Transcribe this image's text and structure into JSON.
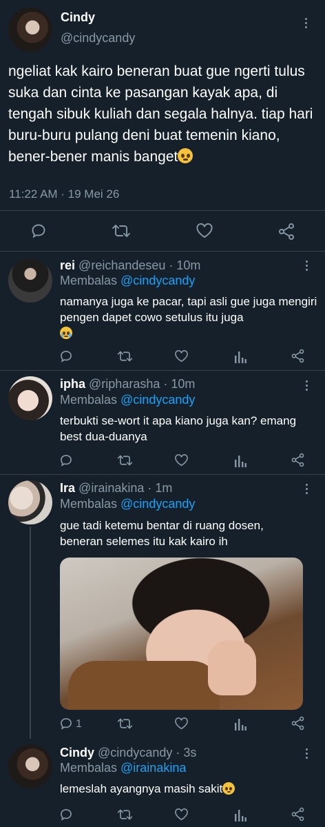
{
  "main_tweet": {
    "name": "Cindy",
    "handle": "@cindycandy",
    "text": "ngeliat kak kairo beneran buat gue ngerti tulus suka dan cinta ke pasangan kayak apa, di tengah sibuk kuliah dan segala halnya. tiap hari buru-buru pulang deni buat temenin kiano, bener-bener manis banget",
    "time": "11:22 AM · 19 Mei 26"
  },
  "replies": [
    {
      "name": "rei",
      "handle": "@reichandeseu",
      "age": " · 10m",
      "replying_label": "Membalas ",
      "replying_to": "@cindycandy",
      "text": "namanya juga ke pacar, tapi asli gue juga mengiri pengen dapet cowo setulus itu juga"
    },
    {
      "name": "ipha",
      "handle": "@ripharasha",
      "age": " · 10m",
      "replying_label": "Membalas ",
      "replying_to": "@cindycandy",
      "text": "terbukti se-wort it apa kiano juga kan? emang best dua-duanya"
    },
    {
      "name": "Ira",
      "handle": "@irainakina",
      "age": " · 1m",
      "replying_label": "Membalas ",
      "replying_to": "@cindycandy",
      "text": "gue tadi ketemu bentar di ruang dosen, beneran selemes itu kak kairo ih",
      "reply_count": "1"
    },
    {
      "name": "Cindy",
      "handle": "@cindycandy",
      "age": " · 3s",
      "replying_label": "Membalas ",
      "replying_to": "@irainakina",
      "text": "lemeslah ayangnya masih sakit"
    }
  ],
  "icons": {
    "reply": "speech-bubble-icon",
    "retweet": "retweet-icon",
    "like": "heart-icon",
    "share": "share-icon",
    "analytics": "analytics-icon",
    "more": "vertical-dots-icon"
  },
  "colors": {
    "background": "#15202b",
    "muted": "#8899a6",
    "link": "#1da1f2",
    "divider": "#38444d"
  }
}
